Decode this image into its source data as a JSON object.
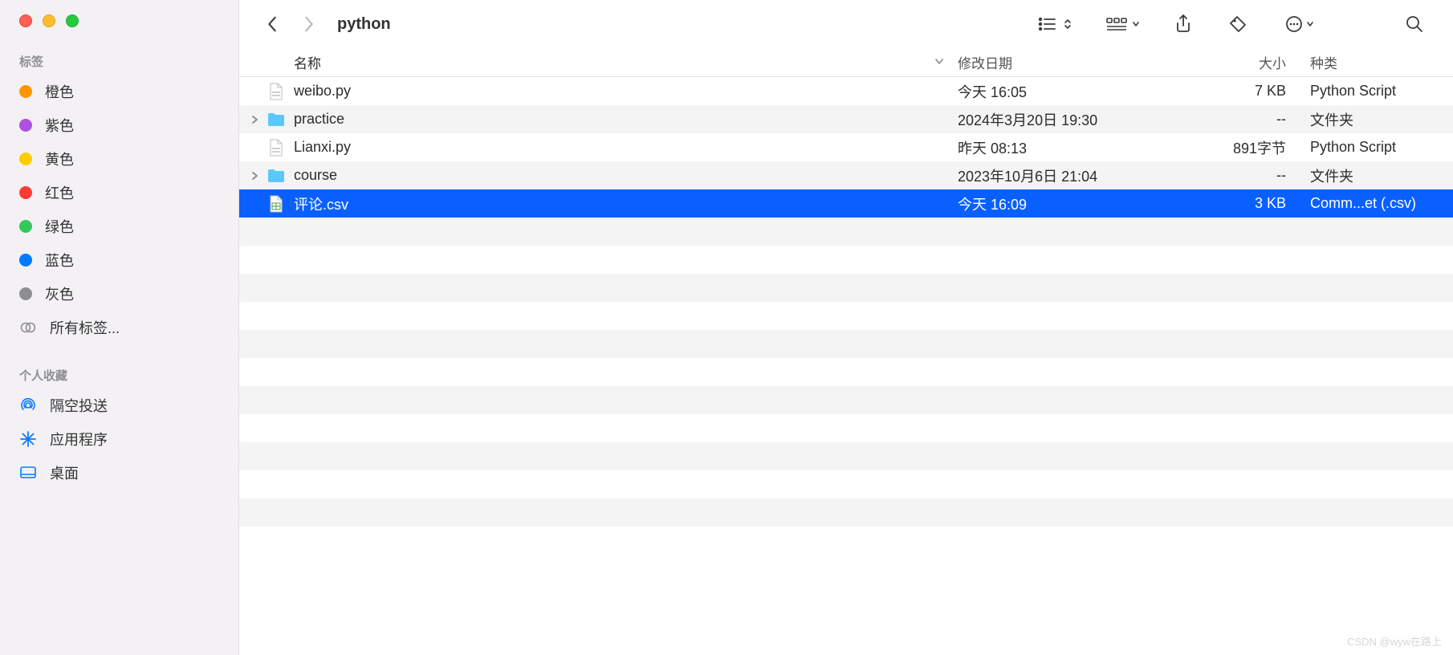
{
  "sidebar": {
    "tags_section": "标签",
    "tags": [
      {
        "label": "橙色",
        "color": "orange"
      },
      {
        "label": "紫色",
        "color": "purple"
      },
      {
        "label": "黄色",
        "color": "yellow"
      },
      {
        "label": "红色",
        "color": "redt"
      },
      {
        "label": "绿色",
        "color": "greent"
      },
      {
        "label": "蓝色",
        "color": "bluet"
      },
      {
        "label": "灰色",
        "color": "gray"
      }
    ],
    "all_tags": "所有标签...",
    "favorites_section": "个人收藏",
    "favorites": [
      {
        "label": "隔空投送",
        "icon": "airdrop"
      },
      {
        "label": "应用程序",
        "icon": "apps"
      },
      {
        "label": "桌面",
        "icon": "desktop"
      }
    ]
  },
  "header": {
    "title": "python",
    "columns": {
      "name": "名称",
      "date": "修改日期",
      "size": "大小",
      "kind": "种类"
    }
  },
  "files": [
    {
      "name": "weibo.py",
      "date": "今天 16:05",
      "size": "7 KB",
      "kind": "Python Script",
      "type": "file",
      "selected": false
    },
    {
      "name": "practice",
      "date": "2024年3月20日 19:30",
      "size": "--",
      "kind": "文件夹",
      "type": "folder",
      "selected": false
    },
    {
      "name": "Lianxi.py",
      "date": "昨天 08:13",
      "size": "891字节",
      "kind": "Python Script",
      "type": "file",
      "selected": false
    },
    {
      "name": "course",
      "date": "2023年10月6日 21:04",
      "size": "--",
      "kind": "文件夹",
      "type": "folder",
      "selected": false
    },
    {
      "name": "评论.csv",
      "date": "今天 16:09",
      "size": "3 KB",
      "kind": "Comm...et (.csv)",
      "type": "csv",
      "selected": true
    }
  ],
  "watermark": "CSDN @wyw在路上"
}
